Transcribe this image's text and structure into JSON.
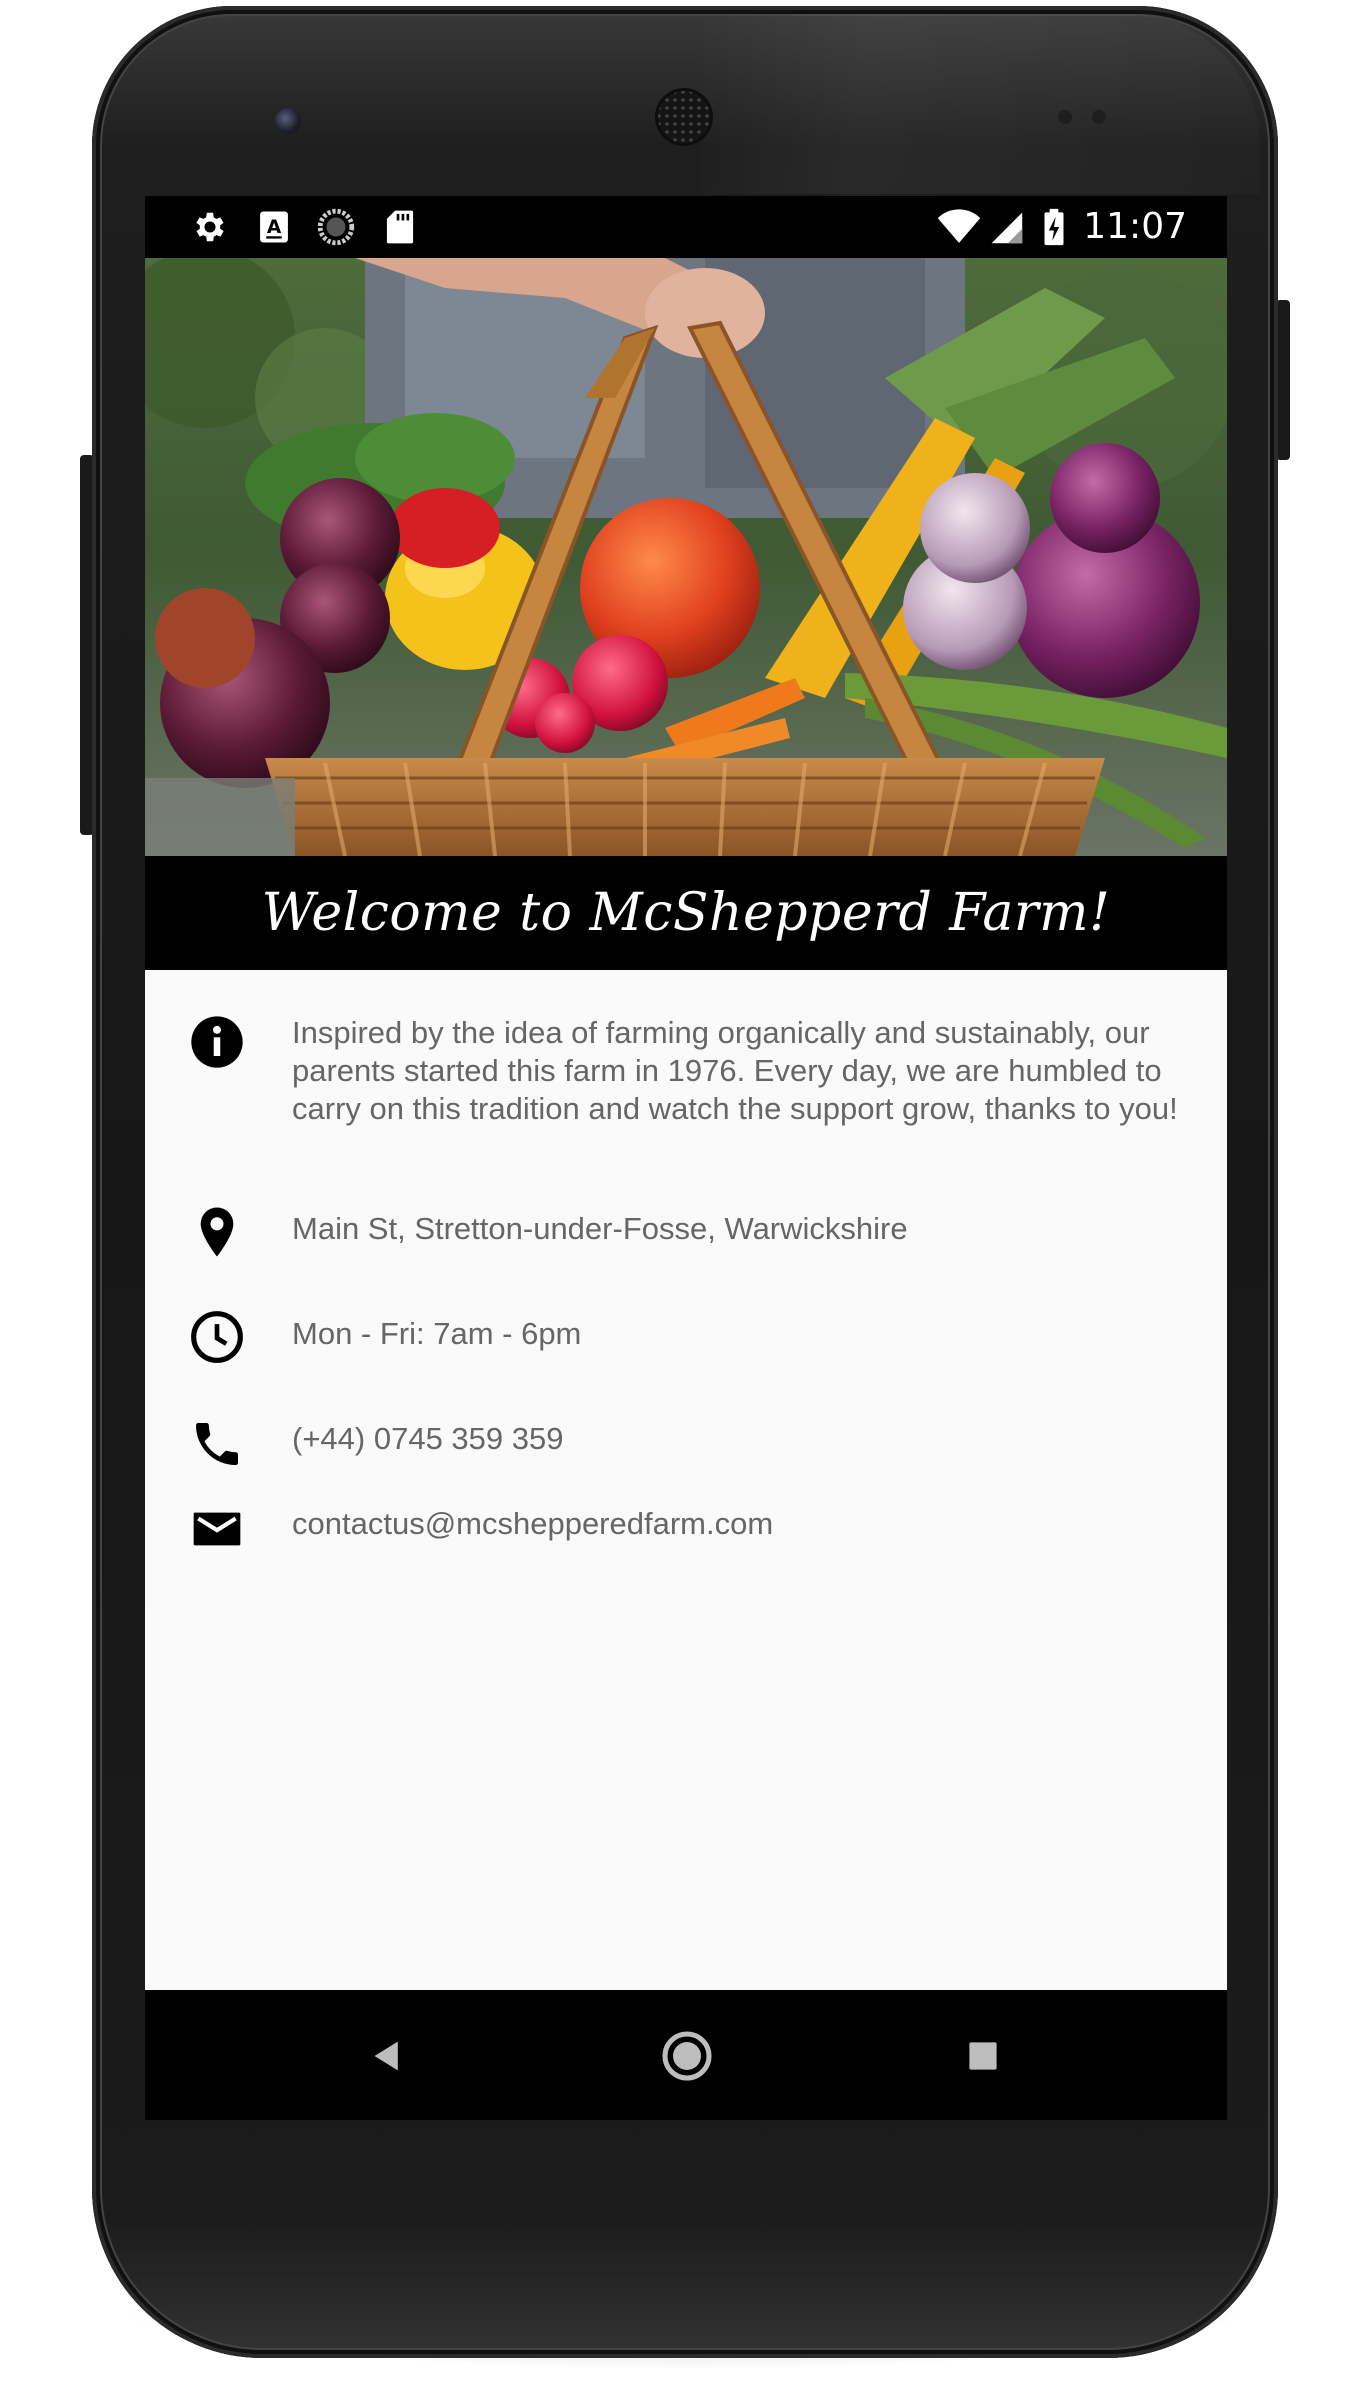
{
  "status_bar": {
    "time": "11:07",
    "left_icons": [
      "gear-icon",
      "keyboard-a-icon",
      "sync-circle-icon",
      "sd-card-icon"
    ],
    "right_icons": [
      "wifi-icon",
      "cell-signal-icon",
      "battery-charging-icon"
    ]
  },
  "header": {
    "welcome": "Welcome to McShepperd Farm!"
  },
  "info": {
    "about": "Inspired by the idea of farming organically and sustainably, our parents started this farm in 1976. Every day, we are humbled to carry on this tradition and watch the support grow, thanks to you!",
    "address": "Main St, Stretton-under-Fosse, Warwickshire",
    "hours": "Mon - Fri: 7am - 6pm",
    "phone": "(+44) 0745 359 359",
    "email": "contactus@mcshepperedfarm.com"
  },
  "colors": {
    "text": "#666666",
    "background": "#fafafa",
    "bars": "#000000"
  },
  "nav": {
    "icons": [
      "back-icon",
      "home-icon",
      "recents-icon"
    ]
  }
}
